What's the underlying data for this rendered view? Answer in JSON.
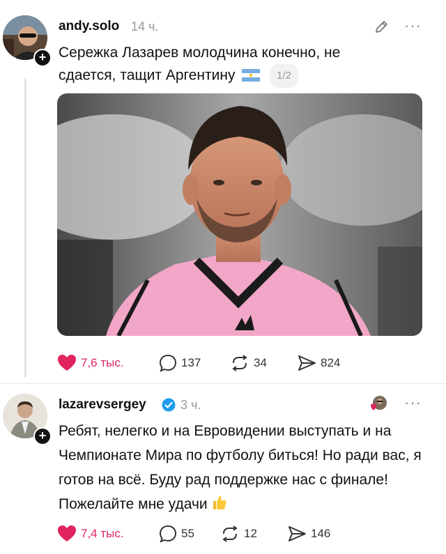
{
  "posts": [
    {
      "username": "andy.solo",
      "time": "14 ч.",
      "text": "Сережка Лазарев молодчина конечно, не сдается, тащит Аргентину",
      "flag_icon": "argentina-flag-icon",
      "media_pager": "1/2",
      "likes": "7,6 тыс.",
      "comments": "137",
      "reposts": "34",
      "shares": "824"
    },
    {
      "username": "lazarevsergey",
      "verified": true,
      "time": "3 ч.",
      "text": "Ребят, нелегко и на Евровидении выступать и на Чемпионате Мира по футболу биться! Но ради вас, я готов на всё. Буду рад поддержке нас с финале! Пожелайте мне удачи",
      "thumbs_icon": "thumbs-up-emoji-icon",
      "likes": "7,4 тыс.",
      "comments": "55",
      "reposts": "12",
      "shares": "146"
    }
  ],
  "colors": {
    "like": "#e0245e",
    "verified": "#1d9bf0",
    "muted": "#9a9a9a",
    "jersey": "#f2a6c8"
  }
}
